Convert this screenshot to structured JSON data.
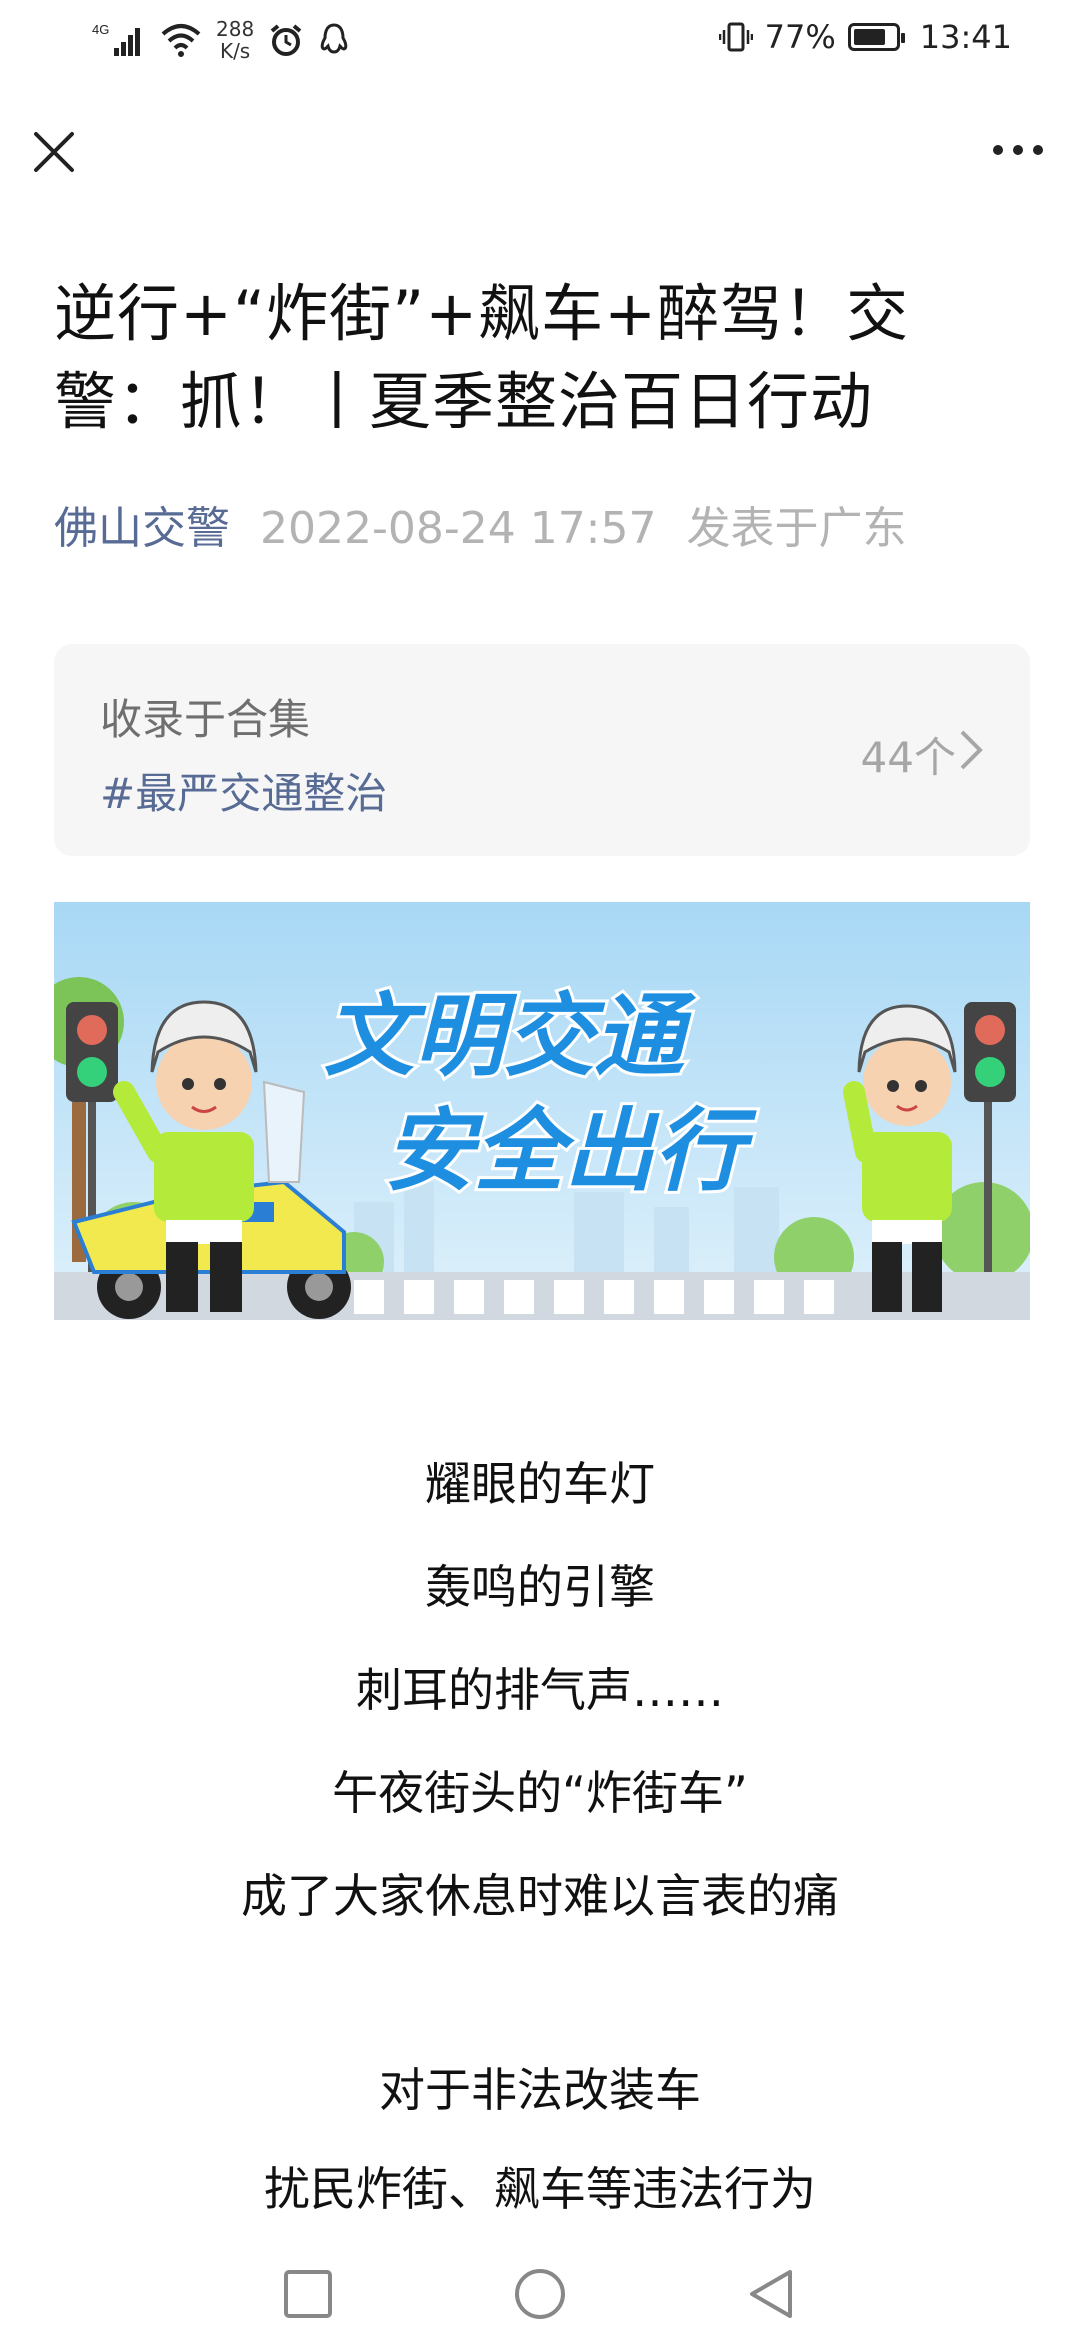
{
  "status_bar": {
    "network": "4G",
    "speed_value": "288",
    "speed_unit": "K/s",
    "battery": "77%",
    "battery_level": 0.77,
    "time": "13:41"
  },
  "article": {
    "title": "逆行+“炸街”+飙车+醉驾！交警：抓！丨夏季整治百日行动",
    "author": "佛山交警",
    "datetime": "2022-08-24 17:57",
    "location": "发表于广东"
  },
  "album": {
    "label": "收录于合集",
    "tag": "#最严交通整治",
    "count": "44个"
  },
  "banner": {
    "line1": "文明交通",
    "line2": "安全出行"
  },
  "body_lines": [
    "耀眼的车灯",
    "轰鸣的引擎",
    "刺耳的排气声……",
    "午夜街头的“炸街车”",
    "成了大家休息时难以言表的痛",
    "对于非法改装车",
    "扰民炸街、飙车等违法行为"
  ],
  "colors": {
    "link": "#576b95",
    "meta": "#b3b3b3",
    "album_bg": "#f6f6f6",
    "banner_sky": "#bfe3f7",
    "banner_text": "#1e8fe0"
  }
}
